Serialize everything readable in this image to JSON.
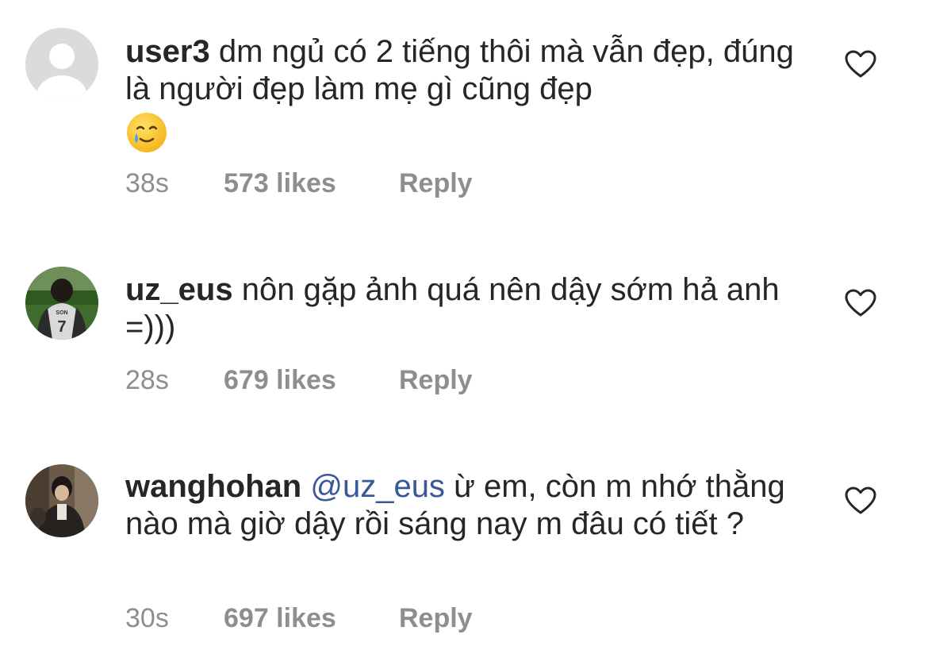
{
  "comments": [
    {
      "username": "user3",
      "mention": "",
      "text": "dm ngủ có 2 tiếng thôi mà vẫn đẹp, đúng là người đẹp làm mẹ gì cũng đẹp",
      "emoji": "smiling-face-with-tear",
      "time": "38s",
      "likes": "573 likes",
      "reply": "Reply",
      "avatar": "default-avatar-icon"
    },
    {
      "username": "uz_eus",
      "mention": "",
      "text": "nôn gặp ảnh quá nên dậy sớm hả anh =)))",
      "time": "28s",
      "likes": "679 likes",
      "reply": "Reply",
      "avatar": "profile-photo"
    },
    {
      "username": "wanghohan",
      "mention": "@uz_eus",
      "text": "ừ em, còn m nhớ thằng nào mà giờ dậy rồi sáng nay m đâu có tiết ?",
      "time": "30s",
      "likes": "697 likes",
      "reply": "Reply",
      "avatar": "profile-photo"
    }
  ],
  "colors": {
    "text": "#262626",
    "meta": "#8e8e8e",
    "mention": "#385898"
  }
}
